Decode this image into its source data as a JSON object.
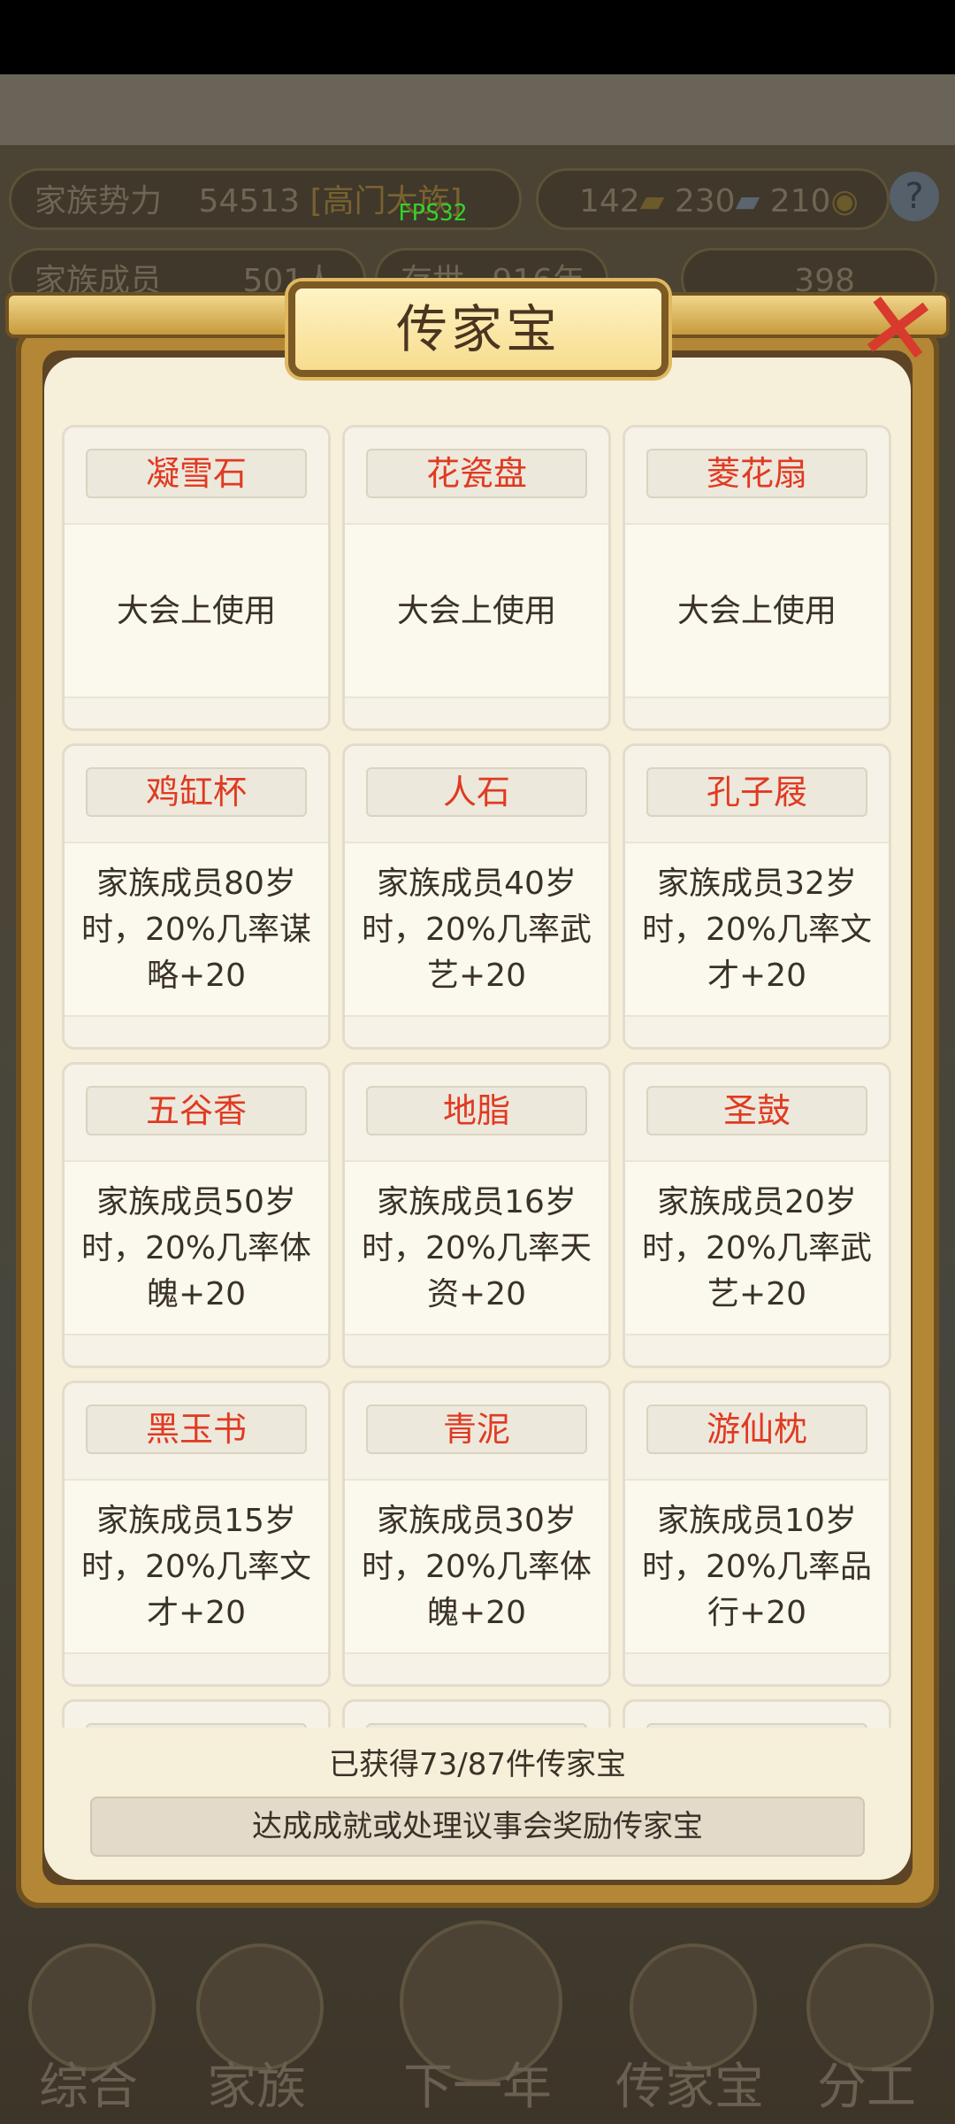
{
  "background": {
    "stats": {
      "clan_power_label": "家族势力",
      "clan_power_value": "54513",
      "clan_rank_bracket": "[高门大族]",
      "res1": "142",
      "res2": "230",
      "res3": "210",
      "members_label": "家族成员",
      "members_value": "501人",
      "years_label": "存世",
      "years_value": "916年",
      "gold": "398"
    },
    "fps": "FPS32",
    "nav": [
      "综合",
      "家族",
      "下一年",
      "传家宝",
      "分工"
    ]
  },
  "dialog": {
    "title": "传家宝",
    "items": [
      {
        "name": "凝雪石",
        "desc": "大会上使用"
      },
      {
        "name": "花瓷盘",
        "desc": "大会上使用"
      },
      {
        "name": "菱花扇",
        "desc": "大会上使用"
      },
      {
        "name": "鸡缸杯",
        "desc": "家族成员80岁时，20%几率谋略+20"
      },
      {
        "name": "人石",
        "desc": "家族成员40岁时，20%几率武艺+20"
      },
      {
        "name": "孔子屐",
        "desc": "家族成员32岁时，20%几率文才+20"
      },
      {
        "name": "五谷香",
        "desc": "家族成员50岁时，20%几率体魄+20"
      },
      {
        "name": "地脂",
        "desc": "家族成员16岁时，20%几率天资+20"
      },
      {
        "name": "圣鼓",
        "desc": "家族成员20岁时，20%几率武艺+20"
      },
      {
        "name": "黑玉书",
        "desc": "家族成员15岁时，20%几率文才+20"
      },
      {
        "name": "青泥",
        "desc": "家族成员30岁时，20%几率体魄+20"
      },
      {
        "name": "游仙枕",
        "desc": "家族成员10岁时，20%几率品行+20"
      }
    ],
    "obtained_text": "已获得73/87件传家宝",
    "hint_text": "达成成就或处理议事会奖励传家宝"
  }
}
